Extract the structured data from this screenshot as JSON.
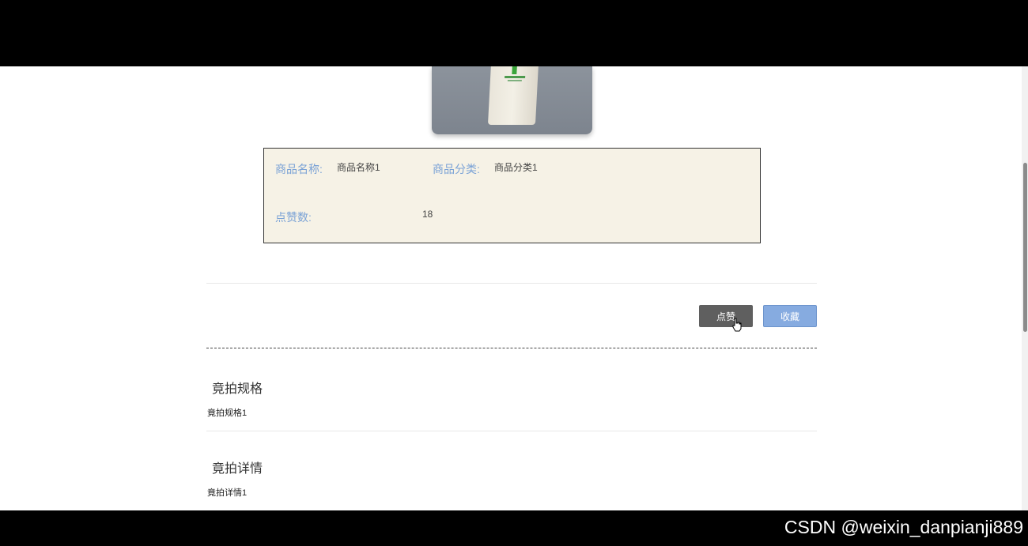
{
  "product": {
    "name_label": "商品名称:",
    "name_value": "商品名称1",
    "category_label": "商品分类:",
    "category_value": "商品分类1",
    "likes_label": "点赞数:",
    "likes_value": "18"
  },
  "actions": {
    "like_label": "点赞",
    "favorite_label": "收藏"
  },
  "sections": [
    {
      "title": "竟拍规格",
      "content": "竟拍规格1"
    },
    {
      "title": "竟拍详情",
      "content": "竟拍详情1"
    }
  ],
  "watermark": "CSDN @weixin_danpianji889",
  "colors": {
    "label_blue": "#7aa2d6",
    "info_bg": "#f6f2e6",
    "like_button": "#5f5f5f",
    "favorite_button": "#86abe0"
  }
}
